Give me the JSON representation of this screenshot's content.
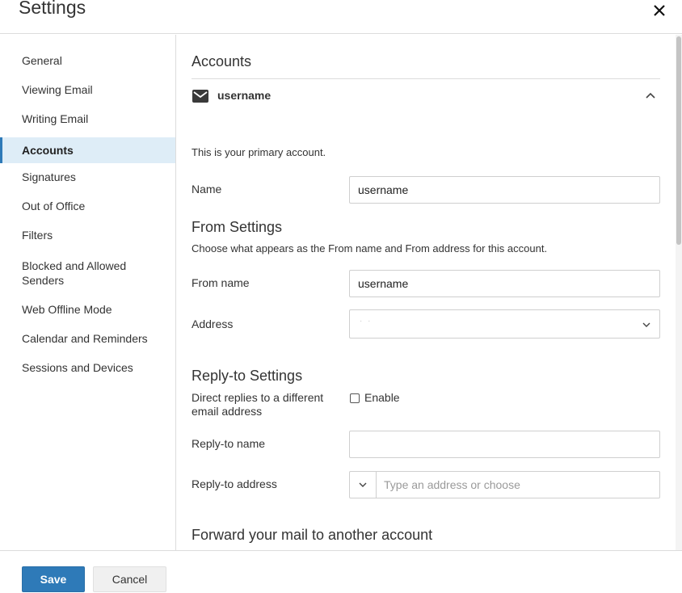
{
  "header": {
    "title": "Settings",
    "close_icon": "close-icon"
  },
  "sidebar": {
    "items": [
      {
        "label": "General"
      },
      {
        "label": "Viewing Email"
      },
      {
        "label": "Writing Email"
      },
      {
        "label": "Accounts",
        "active": true
      },
      {
        "label": "Signatures"
      },
      {
        "label": "Out of Office"
      },
      {
        "label": "Filters"
      },
      {
        "label": "Blocked and Allowed Senders"
      },
      {
        "label": "Web Offline Mode"
      },
      {
        "label": "Calendar and Reminders"
      },
      {
        "label": "Sessions and Devices"
      }
    ]
  },
  "main": {
    "heading": "Accounts",
    "account": {
      "icon": "mail-icon",
      "name": "username",
      "toggle_icon": "chevron-up-icon"
    },
    "primary_text": "This is your primary account.",
    "name_field": {
      "label": "Name",
      "value": "username"
    },
    "from_settings": {
      "heading": "From Settings",
      "description": "Choose what appears as the From name and From address for this account.",
      "from_name": {
        "label": "From name",
        "value": "username"
      },
      "address": {
        "label": "Address",
        "value": "· ·"
      }
    },
    "reply_to": {
      "heading": "Reply-to Settings",
      "direct_label": "Direct replies to a different email address",
      "enable_label": "Enable",
      "enabled": false,
      "name_label": "Reply-to name",
      "name_value": "",
      "address_label": "Reply-to address",
      "address_placeholder": "Type an address or choose"
    },
    "forward_heading": "Forward your mail to another account"
  },
  "footer": {
    "save_label": "Save",
    "cancel_label": "Cancel"
  },
  "colors": {
    "accent": "#2e7ab8",
    "active_nav_bg": "#deedf7"
  }
}
